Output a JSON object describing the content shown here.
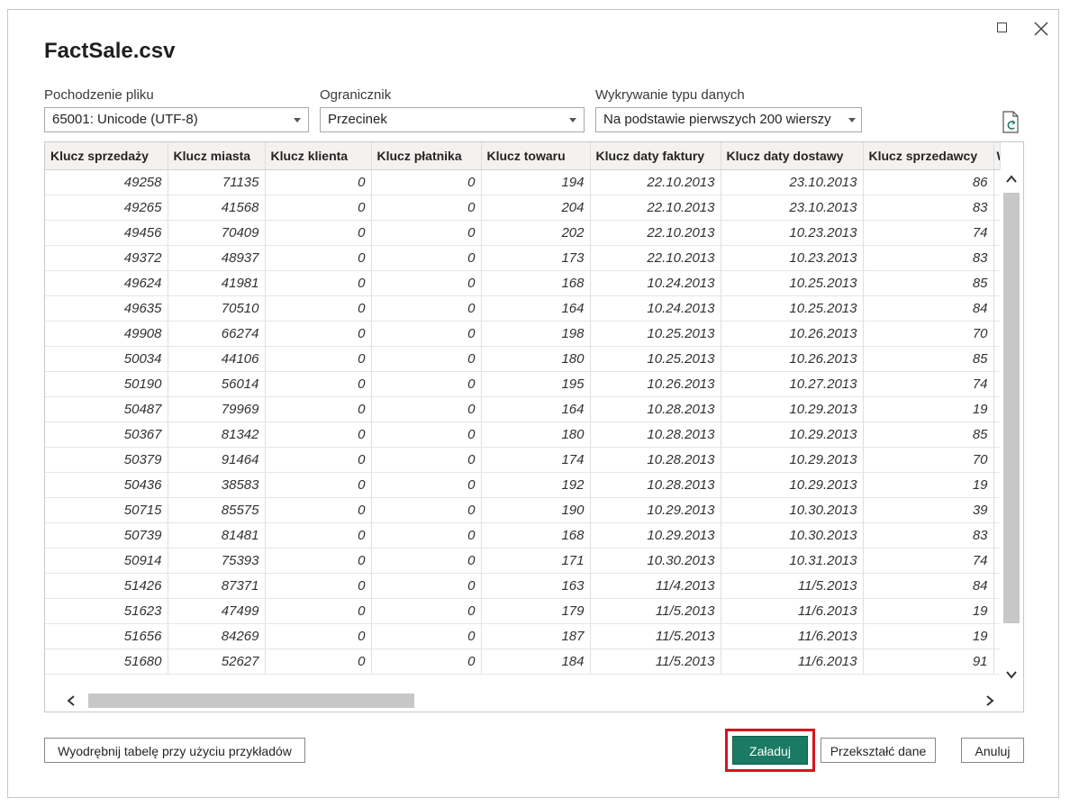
{
  "dialog": {
    "title": "FactSale.csv"
  },
  "options": {
    "file_origin": {
      "label": "Pochodzenie pliku",
      "value": "65001: Unicode (UTF-8)"
    },
    "delimiter": {
      "label": "Ogranicznik",
      "value": "Przecinek"
    },
    "type_detection": {
      "label": "Wykrywanie typu danych",
      "value": "Na podstawie pierwszych 200 wierszy"
    }
  },
  "table": {
    "columns": [
      "Klucz sprzedaży",
      "Klucz miasta",
      "Klucz klienta",
      "Klucz płatnika",
      "Klucz towaru",
      "Klucz daty faktury",
      "Klucz daty dostawy",
      "Klucz sprzedawcy",
      "W"
    ],
    "rows": [
      [
        "49258",
        "71135",
        "0",
        "0",
        "194",
        "22.10.2013",
        "23.10.2013",
        "86"
      ],
      [
        "49265",
        "41568",
        "0",
        "0",
        "204",
        "22.10.2013",
        "23.10.2013",
        "83"
      ],
      [
        "49456",
        "70409",
        "0",
        "0",
        "202",
        "22.10.2013",
        "10.23.2013",
        "74"
      ],
      [
        "49372",
        "48937",
        "0",
        "0",
        "173",
        "22.10.2013",
        "10.23.2013",
        "83"
      ],
      [
        "49624",
        "41981",
        "0",
        "0",
        "168",
        "10.24.2013",
        "10.25.2013",
        "85"
      ],
      [
        "49635",
        "70510",
        "0",
        "0",
        "164",
        "10.24.2013",
        "10.25.2013",
        "84"
      ],
      [
        "49908",
        "66274",
        "0",
        "0",
        "198",
        "10.25.2013",
        "10.26.2013",
        "70"
      ],
      [
        "50034",
        "44106",
        "0",
        "0",
        "180",
        "10.25.2013",
        "10.26.2013",
        "85"
      ],
      [
        "50190",
        "56014",
        "0",
        "0",
        "195",
        "10.26.2013",
        "10.27.2013",
        "74"
      ],
      [
        "50487",
        "79969",
        "0",
        "0",
        "164",
        "10.28.2013",
        "10.29.2013",
        "19"
      ],
      [
        "50367",
        "81342",
        "0",
        "0",
        "180",
        "10.28.2013",
        "10.29.2013",
        "85"
      ],
      [
        "50379",
        "91464",
        "0",
        "0",
        "174",
        "10.28.2013",
        "10.29.2013",
        "70"
      ],
      [
        "50436",
        "38583",
        "0",
        "0",
        "192",
        "10.28.2013",
        "10.29.2013",
        "19"
      ],
      [
        "50715",
        "85575",
        "0",
        "0",
        "190",
        "10.29.2013",
        "10.30.2013",
        "39"
      ],
      [
        "50739",
        "81481",
        "0",
        "0",
        "168",
        "10.29.2013",
        "10.30.2013",
        "83"
      ],
      [
        "50914",
        "75393",
        "0",
        "0",
        "171",
        "10.30.2013",
        "10.31.2013",
        "74"
      ],
      [
        "51426",
        "87371",
        "0",
        "0",
        "163",
        "11/4.2013",
        "11/5.2013",
        "84"
      ],
      [
        "51623",
        "47499",
        "0",
        "0",
        "179",
        "11/5.2013",
        "11/6.2013",
        "19"
      ],
      [
        "51656",
        "84269",
        "0",
        "0",
        "187",
        "11/5.2013",
        "11/6.2013",
        "19"
      ],
      [
        "51680",
        "52627",
        "0",
        "0",
        "184",
        "11/5.2013",
        "11/6.2013",
        "91"
      ]
    ]
  },
  "buttons": {
    "extract": "Wyodrębnij tabelę przy użyciu przykładów",
    "load": "Załaduj",
    "transform": "Przekształć dane",
    "cancel": "Anuluj"
  },
  "colors": {
    "load_button": "#1a7a63",
    "highlight_border": "#d6141e"
  },
  "icons": [
    "maximize-icon",
    "close-icon",
    "refresh-preview-icon",
    "chevron-up-icon",
    "chevron-down-icon",
    "chevron-left-icon",
    "chevron-right-icon",
    "loading-icon"
  ]
}
